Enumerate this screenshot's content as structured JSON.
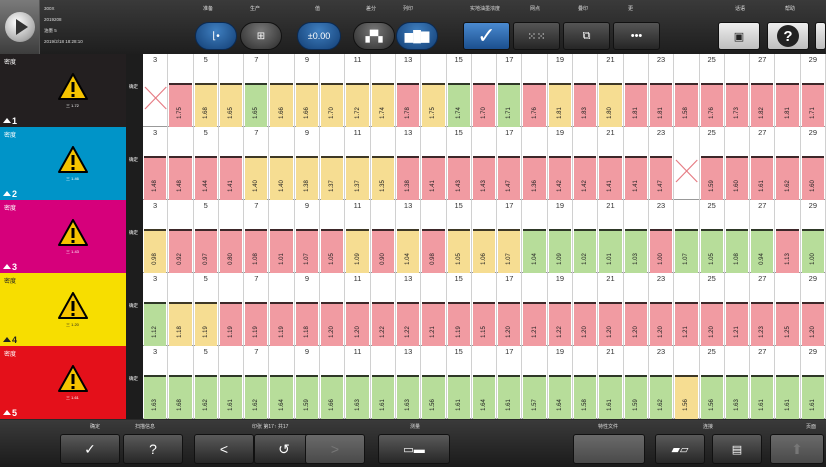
{
  "colors": {
    "row_black": "#231f20",
    "row_cyan": "#0094c8",
    "row_magenta": "#d6007b",
    "row_yellow": "#f7de00",
    "row_red": "#e4101a",
    "bar_red": "#f19ba2",
    "bar_yellow": "#f6dd92",
    "bar_green": "#b7dd9a"
  },
  "jobinfo": {
    "line1": "300X",
    "line2": "2019208",
    "line3": "油墨 5",
    "line4": "2019/2/18 18:28:10"
  },
  "toolbar": {
    "labels": [
      "准备",
      "生产",
      "值",
      "差分",
      "列印",
      "实地油墨浓度",
      "网点",
      "叠印",
      "更",
      "话语",
      "帮助"
    ],
    "zero_label": "±0.00"
  },
  "zones": [
    "3",
    "",
    "5",
    "",
    "7",
    "",
    "9",
    "",
    "11",
    "",
    "13",
    "",
    "15",
    "",
    "17",
    "",
    "19",
    "",
    "21",
    "",
    "23",
    "",
    "25",
    "",
    "27",
    "",
    "29"
  ],
  "rows": [
    {
      "key": "black",
      "title": "密度",
      "number": "1",
      "measured": "确定",
      "sub": "三 1.72",
      "values": [
        "",
        "1.75",
        "1.68",
        "1.65",
        "1.65",
        "1.66",
        "1.66",
        "1.70",
        "1.72",
        "1.74",
        "1.78",
        "1.75",
        "1.74",
        "1.70",
        "1.71",
        "1.76",
        "1.81",
        "1.83",
        "1.80",
        "1.81",
        "1.81",
        "1.58",
        "1.76",
        "1.73",
        "1.82",
        "1.81",
        "1.71"
      ],
      "status": [
        "x",
        "r",
        "y",
        "y",
        "g",
        "y",
        "y",
        "y",
        "y",
        "y",
        "r",
        "y",
        "g",
        "r",
        "g",
        "r",
        "y",
        "r",
        "y",
        "r",
        "r",
        "r",
        "r",
        "r",
        "r",
        "r",
        "r"
      ]
    },
    {
      "key": "cyan",
      "title": "密度",
      "number": "2",
      "measured": "确定",
      "sub": "三 1.46",
      "values": [
        "1.48",
        "1.48",
        "1.44",
        "1.41",
        "1.40",
        "1.40",
        "1.38",
        "1.37",
        "1.37",
        "1.35",
        "1.38",
        "1.41",
        "1.43",
        "1.43",
        "1.47",
        "1.36",
        "1.42",
        "1.42",
        "1.41",
        "1.41",
        "1.47",
        "",
        "1.59",
        "1.60",
        "1.61",
        "1.62",
        "1.60"
      ],
      "status": [
        "r",
        "r",
        "r",
        "r",
        "y",
        "y",
        "y",
        "y",
        "y",
        "y",
        "r",
        "r",
        "r",
        "r",
        "r",
        "r",
        "r",
        "r",
        "r",
        "r",
        "r",
        "x",
        "r",
        "r",
        "r",
        "r",
        "r"
      ]
    },
    {
      "key": "magenta",
      "title": "密度",
      "number": "3",
      "measured": "确定",
      "sub": "三 1.43",
      "values": [
        "0.98",
        "0.92",
        "0.97",
        "0.80",
        "1.08",
        "1.01",
        "1.07",
        "1.05",
        "1.09",
        "0.90",
        "1.04",
        "0.98",
        "1.05",
        "1.06",
        "1.07",
        "1.04",
        "1.09",
        "1.02",
        "1.01",
        "1.03",
        "1.00",
        "1.07",
        "1.05",
        "1.08",
        "0.94",
        "1.13",
        "1.00"
      ],
      "status": [
        "y",
        "r",
        "r",
        "r",
        "r",
        "r",
        "r",
        "r",
        "y",
        "r",
        "y",
        "r",
        "y",
        "y",
        "y",
        "g",
        "g",
        "g",
        "g",
        "g",
        "r",
        "g",
        "g",
        "g",
        "g",
        "r",
        "g"
      ]
    },
    {
      "key": "yellow",
      "title": "密度",
      "number": "4",
      "measured": "确定",
      "sub": "三 1.20",
      "values": [
        "1.12",
        "1.18",
        "1.19",
        "1.19",
        "1.19",
        "1.19",
        "1.18",
        "1.20",
        "1.20",
        "1.22",
        "1.22",
        "1.21",
        "1.19",
        "1.15",
        "1.20",
        "1.21",
        "1.22",
        "1.20",
        "1.20",
        "1.20",
        "1.20",
        "1.21",
        "1.20",
        "1.21",
        "1.23",
        "1.25",
        "1.20"
      ],
      "status": [
        "g",
        "y",
        "y",
        "r",
        "r",
        "r",
        "r",
        "r",
        "r",
        "r",
        "r",
        "r",
        "r",
        "r",
        "r",
        "r",
        "r",
        "r",
        "r",
        "r",
        "r",
        "r",
        "r",
        "r",
        "r",
        "r",
        "r"
      ]
    },
    {
      "key": "red",
      "title": "密度",
      "number": "5",
      "measured": "确定",
      "sub": "三 1.61",
      "values": [
        "1.63",
        "1.68",
        "1.62",
        "1.61",
        "1.62",
        "1.64",
        "1.59",
        "1.66",
        "1.63",
        "1.61",
        "1.63",
        "1.56",
        "1.61",
        "1.64",
        "1.61",
        "1.57",
        "1.64",
        "1.58",
        "1.61",
        "1.59",
        "1.62",
        "1.56",
        "1.56",
        "1.63",
        "1.61",
        "1.61",
        "1.61"
      ],
      "status": [
        "g",
        "g",
        "g",
        "g",
        "g",
        "g",
        "g",
        "g",
        "g",
        "g",
        "g",
        "g",
        "g",
        "g",
        "g",
        "g",
        "g",
        "g",
        "g",
        "g",
        "g",
        "y",
        "g",
        "g",
        "g",
        "g",
        "g"
      ]
    }
  ],
  "bottombar": {
    "labels": [
      "确定",
      "扫描信息",
      "印张 第17↑ 共17",
      "测量",
      "特性文件",
      "连接",
      "页面"
    ],
    "prev": "<",
    "next": ">",
    "doc": "?",
    "check": "✓",
    "up": "⬆"
  }
}
